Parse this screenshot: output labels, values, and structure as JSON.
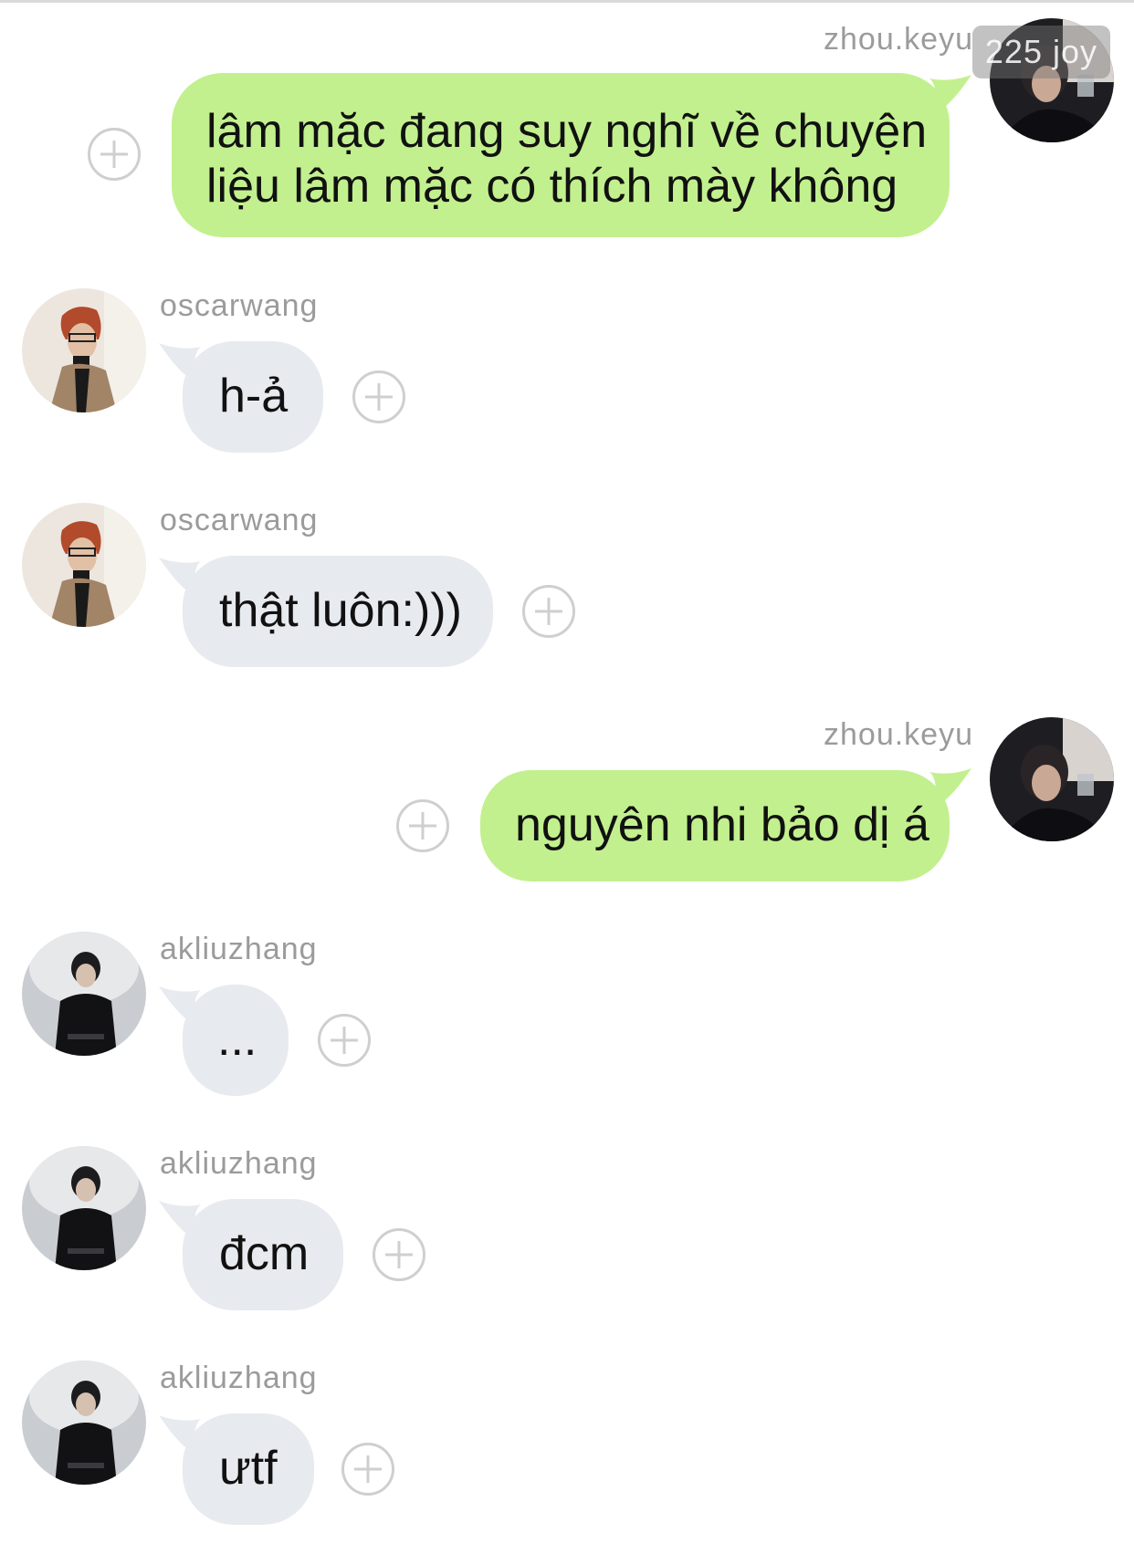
{
  "messages": [
    {
      "sender": "zhou.keyu",
      "text": "lâm mặc đang suy nghĩ về chuyện\nliệu lâm mặc có thích mày không",
      "direction": "outgoing"
    },
    {
      "sender": "oscarwang",
      "text": "h-ả",
      "direction": "incoming"
    },
    {
      "sender": "oscarwang",
      "text": "thật luôn:)))",
      "direction": "incoming"
    },
    {
      "sender": "zhou.keyu",
      "text": "nguyên nhi bảo dị á",
      "direction": "outgoing"
    },
    {
      "sender": "akliuzhang",
      "text": "...",
      "direction": "incoming"
    },
    {
      "sender": "akliuzhang",
      "text": "đcm",
      "direction": "incoming"
    },
    {
      "sender": "akliuzhang",
      "text": "ưtf",
      "direction": "incoming"
    }
  ],
  "watermark": "225 joy",
  "colors": {
    "outgoing_bubble": "#c2f08e",
    "incoming_bubble": "#e7eaee",
    "username": "#9b9b9b",
    "plus_icon": "#cfcfcf"
  },
  "icons": {
    "react": "plus-circle-icon"
  }
}
